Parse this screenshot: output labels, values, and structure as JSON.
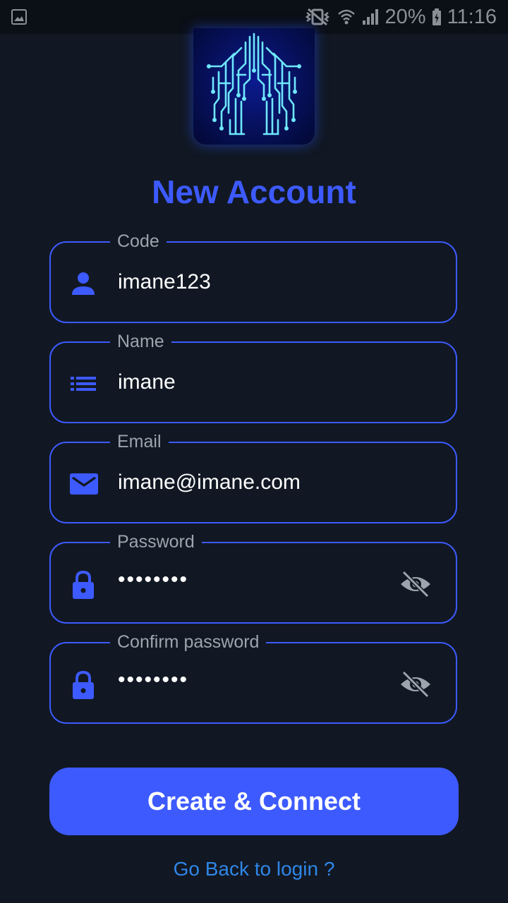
{
  "status_bar": {
    "battery": "20%",
    "time": "11:16",
    "icons": [
      "image-icon",
      "vibrate-mute-icon",
      "wifi-icon",
      "signal-icon",
      "battery-charging-icon"
    ]
  },
  "logo": {
    "icon": "circuit-house-icon"
  },
  "title": "New Account",
  "fields": {
    "code": {
      "label": "Code",
      "value": "imane123",
      "icon": "person-icon"
    },
    "name": {
      "label": "Name",
      "value": "imane",
      "icon": "list-icon"
    },
    "email": {
      "label": "Email",
      "value": "imane@imane.com",
      "icon": "mail-icon"
    },
    "password": {
      "label": "Password",
      "value": "••••••••",
      "icon": "lock-icon",
      "toggle_icon": "eye-off-icon"
    },
    "confirm_password": {
      "label": "Confirm password",
      "value": "••••••••",
      "icon": "lock-icon",
      "toggle_icon": "eye-off-icon"
    }
  },
  "create_button": "Create & Connect",
  "back_link": "Go Back to login ?",
  "colors": {
    "background": "#111823",
    "accent": "#3d5afe",
    "link": "#2f86e8",
    "label": "#9ea4ad"
  }
}
